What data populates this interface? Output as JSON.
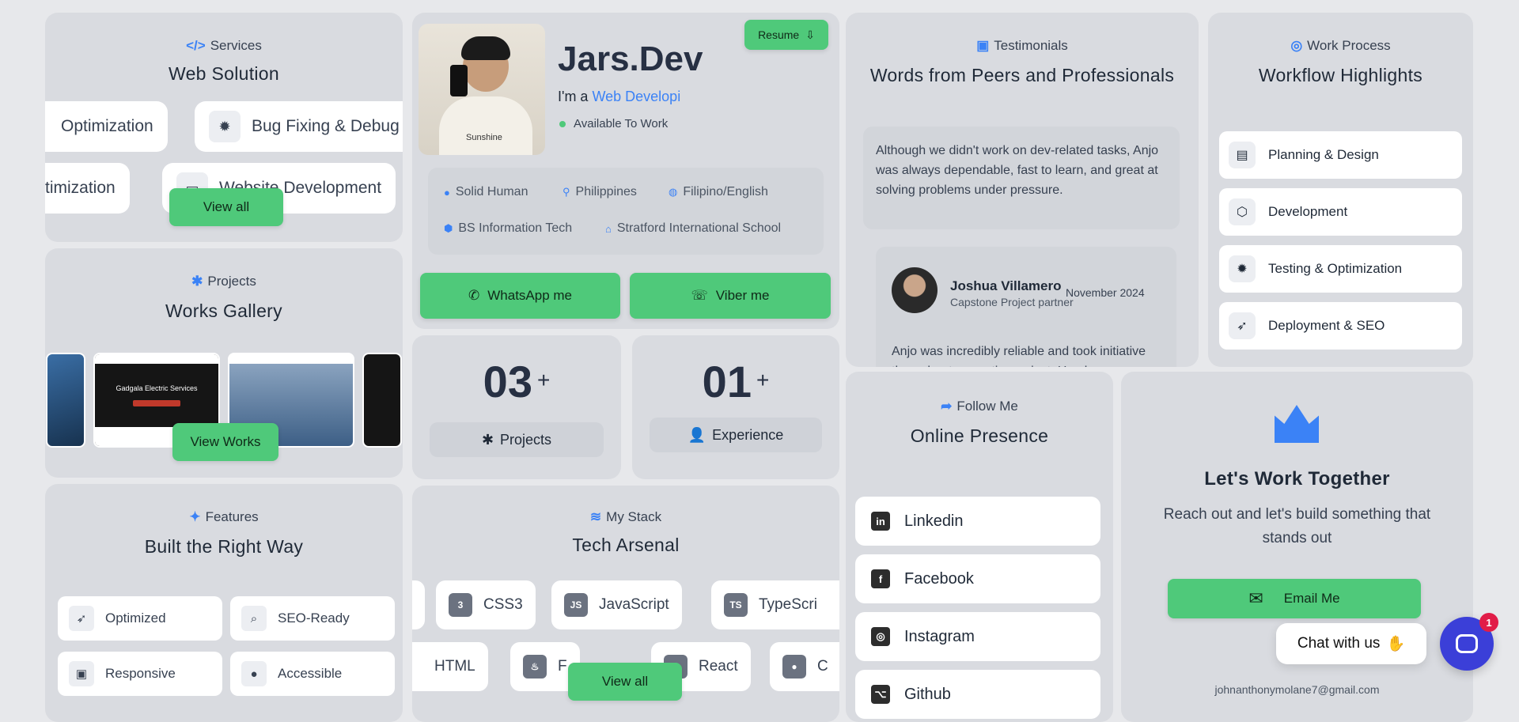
{
  "services": {
    "eyebrow": "Services",
    "title": "Web Solution",
    "row1": [
      "Optimization",
      "Bug Fixing & Debug"
    ],
    "row2": [
      "timization",
      "Website Development"
    ],
    "view_all": "View all"
  },
  "projects": {
    "eyebrow": "Projects",
    "title": "Works Gallery",
    "shot_text": "Gadgala Electric Services",
    "view_works": "View Works"
  },
  "features": {
    "eyebrow": "Features",
    "title": "Built the Right Way",
    "items": [
      "Optimized",
      "SEO-Ready",
      "Responsive",
      "Accessible"
    ]
  },
  "profile": {
    "name": "Jars.Dev",
    "role_prefix": "I'm a",
    "role": "Web Developi",
    "status": "Available To Work",
    "resume": "Resume",
    "info": [
      "Solid Human",
      "Philippines",
      "Filipino/English",
      "BS Information Tech",
      "Stratford International School"
    ],
    "whatsapp": "WhatsApp me",
    "viber": "Viber me",
    "shirt": "Sunshine"
  },
  "stats": [
    {
      "num": "03",
      "plus": "+",
      "label": "Projects"
    },
    {
      "num": "01",
      "plus": "+",
      "label": "Experience"
    }
  ],
  "stack": {
    "eyebrow": "My Stack",
    "title": "Tech Arsenal",
    "row1": [
      "CSS3",
      "JavaScript",
      "TypeScri"
    ],
    "row2": [
      "HTML",
      "F",
      "React",
      "C"
    ],
    "view_all": "View all"
  },
  "testimonials": {
    "eyebrow": "Testimonials",
    "title": "Words from Peers and Professionals",
    "quote1": "Although we didn't work on dev-related tasks, Anjo was always dependable, fast to learn, and great at solving problems under pressure.",
    "author": "Joshua Villamero",
    "author_role": "Capstone Project partner",
    "date": "November 2024",
    "quote2": "Anjo was incredibly reliable and took initiative throughout our entire project. He always"
  },
  "work_process": {
    "eyebrow": "Work Process",
    "title": "Workflow Highlights",
    "items": [
      "Planning & Design",
      "Development",
      "Testing & Optimization",
      "Deployment & SEO"
    ]
  },
  "follow": {
    "eyebrow": "Follow Me",
    "title": "Online Presence",
    "items": [
      "Linkedin",
      "Facebook",
      "Instagram",
      "Github"
    ]
  },
  "cta": {
    "title": "Let's Work Together",
    "text": "Reach out and let's build something that stands out",
    "email_btn": "Email Me",
    "email": "johnanthonymolane7@gmail.com"
  },
  "chat": {
    "label": "Chat with us",
    "badge": "1"
  },
  "colors": {
    "accent": "#3b82f6",
    "green": "#4fc97a",
    "chat": "#3b3fd8"
  }
}
